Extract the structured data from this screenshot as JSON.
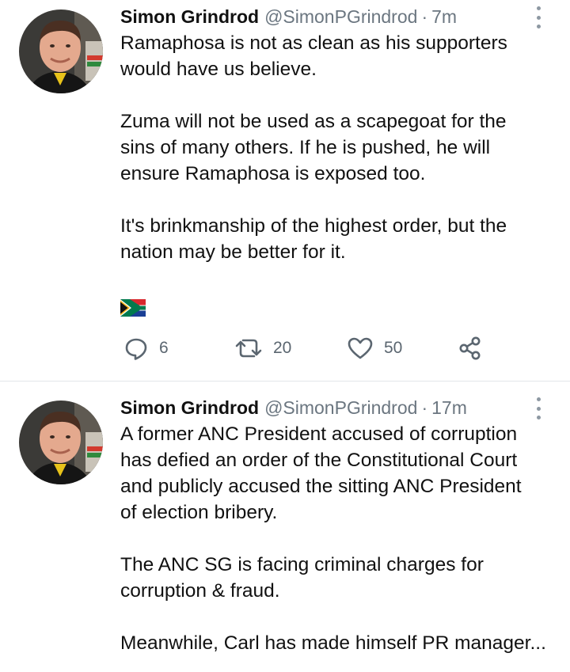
{
  "tweets": [
    {
      "name": "Simon Grindrod",
      "handle": "@SimonPGrindrod",
      "separator": "·",
      "time": "7m",
      "paragraphs": [
        [
          "Ramaphosa is not as clean as his supporters",
          "would have us believe."
        ],
        [
          "Zuma will not be used as a scapegoat for the",
          "sins of many others. If he is pushed, he will",
          "ensure Ramaphosa is exposed too."
        ],
        [
          "It's brinkmanship of the highest order, but the",
          "nation may be better for it."
        ]
      ],
      "emoji": "south-africa-flag",
      "replies": "6",
      "retweets": "20",
      "likes": "50"
    },
    {
      "name": "Simon Grindrod",
      "handle": "@SimonPGrindrod",
      "separator": "·",
      "time": "17m",
      "paragraphs": [
        [
          "A former ANC President accused of corruption",
          "has defied an order of the Constitutional Court",
          "and publicly accused the sitting ANC President",
          "of election bribery."
        ],
        [
          "The ANC SG is facing criminal charges for",
          "corruption & fraud."
        ],
        [
          "Meanwhile, Carl has made himself PR manager..."
        ]
      ]
    }
  ],
  "icons": {
    "reply": "reply-icon",
    "retweet": "retweet-icon",
    "like": "heart-icon",
    "share": "share-icon",
    "more": "more-vertical-icon"
  },
  "colors": {
    "text": "#111111",
    "secondary": "#6b7680",
    "icon": "#5b6670",
    "divider": "#e3e6e9"
  }
}
